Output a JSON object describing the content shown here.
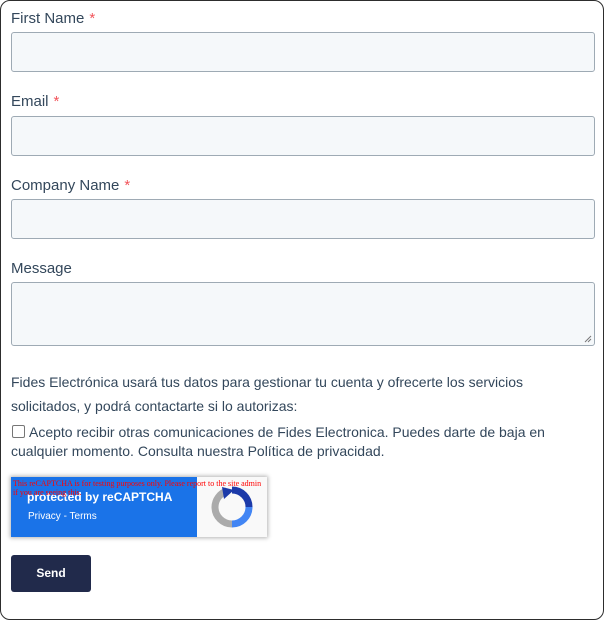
{
  "form": {
    "fields": [
      {
        "label": "First Name",
        "required_mark": "*",
        "value": ""
      },
      {
        "label": "Email",
        "required_mark": "*",
        "value": ""
      },
      {
        "label": "Company Name",
        "required_mark": "*",
        "value": ""
      },
      {
        "label": "Message",
        "value": ""
      }
    ],
    "notice": "Fides Electrónica usará tus datos para gestionar tu cuenta y ofrecerte los servicios solicitados, y podrá contactarte si lo autorizas:",
    "consent": {
      "checked": false,
      "text": "Acepto recibir otras comunicaciones de Fides Electronica. Puedes darte de baja en cualquier momento. Consulta nuestra Política de privacidad."
    },
    "recaptcha": {
      "warning": "This reCAPTCHA is for testing purposes only. Please report to the site admin if you are seeing this.",
      "protected_by": "protected by reCAPTCHA",
      "privacy": "Privacy",
      "separator": "-",
      "terms": "Terms"
    },
    "submit_label": "Send"
  },
  "colors": {
    "required": "#f2545b",
    "button_bg": "#212a4b",
    "input_bg": "#f5f8fa",
    "recaptcha_blue": "#1a73e8"
  }
}
